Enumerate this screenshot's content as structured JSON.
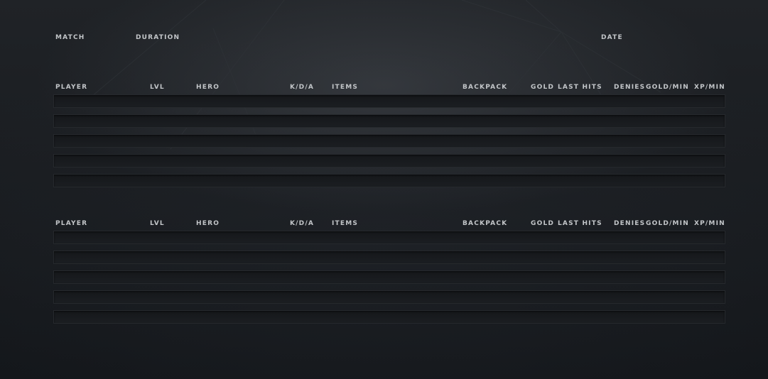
{
  "match_info": {
    "match_label": "MATCH",
    "duration_label": "DURATION",
    "date_label": "DATE"
  },
  "columns": {
    "player": "PLAYER",
    "lvl": "LVL",
    "hero": "HERO",
    "kda": "K/D/A",
    "items": "ITEMS",
    "backpack": "BACKPACK",
    "gold": "GOLD",
    "last_hits": "LAST HITS",
    "denies": "DENIES",
    "gold_min": "GOLD/MIN",
    "xp_min": "XP/MIN"
  },
  "teams": [
    {
      "rows": [
        {},
        {},
        {},
        {},
        {}
      ]
    },
    {
      "rows": [
        {},
        {},
        {},
        {},
        {}
      ]
    }
  ]
}
